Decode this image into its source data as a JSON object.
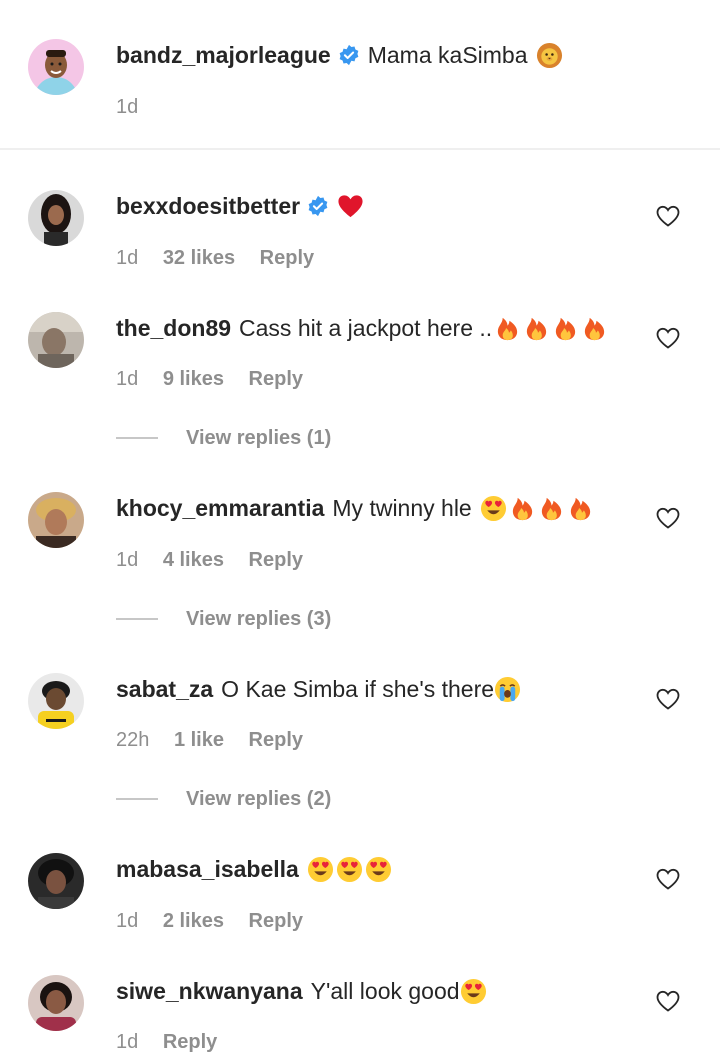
{
  "caption": {
    "username": "bandz_majorleague",
    "text": "Mama kaSimba",
    "emoji": [
      "lion-face"
    ],
    "time": "1d"
  },
  "comments": [
    {
      "username": "bexxdoesitbetter",
      "verified": true,
      "text": "",
      "emoji": [
        "red-heart"
      ],
      "time": "1d",
      "likes": "32 likes",
      "reply": "Reply"
    },
    {
      "username": "the_don89",
      "verified": false,
      "text": "Cass hit a jackpot here ..",
      "emoji": [
        "fire",
        "fire",
        "fire",
        "fire"
      ],
      "time": "1d",
      "likes": "9 likes",
      "reply": "Reply",
      "view_replies": "View replies (1)"
    },
    {
      "username": "khocy_emmarantia",
      "verified": false,
      "text": "My twinny hle",
      "emoji": [
        "heart-eyes",
        "fire",
        "fire",
        "fire"
      ],
      "time": "1d",
      "likes": "4 likes",
      "reply": "Reply",
      "view_replies": "View replies (3)"
    },
    {
      "username": "sabat_za",
      "verified": false,
      "text": "O Kae Simba if she's there",
      "emoji": [
        "loudly-crying"
      ],
      "time": "22h",
      "likes": "1 like",
      "reply": "Reply",
      "view_replies": "View replies (2)"
    },
    {
      "username": "mabasa_isabella",
      "verified": false,
      "text": "",
      "emoji": [
        "heart-eyes",
        "heart-eyes",
        "heart-eyes"
      ],
      "time": "1d",
      "likes": "2 likes",
      "reply": "Reply"
    },
    {
      "username": "siwe_nkwanyana",
      "verified": false,
      "text": "Y'all look good",
      "emoji": [
        "heart-eyes"
      ],
      "time": "1d",
      "likes": "",
      "reply": "Reply"
    }
  ],
  "colors": {
    "username": "#262626",
    "meta": "#8e8e8e",
    "verified": "#3897f0",
    "divider": "#efefef"
  }
}
